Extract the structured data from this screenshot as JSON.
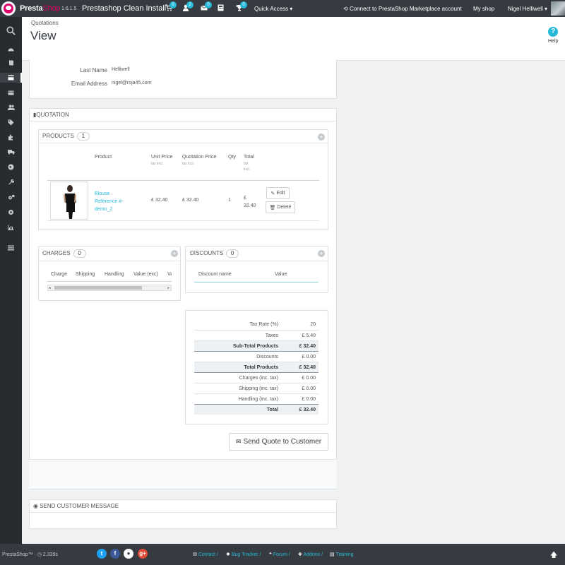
{
  "topbar": {
    "brand_a": "Presta",
    "brand_b": "Shop",
    "version": "1.6.1.5",
    "shop_name": "Prestashop Clean Install",
    "badges": {
      "orders": "0",
      "customers": "2",
      "messages": "0",
      "trophy": "0"
    },
    "quick_access": "Quick Access ▾",
    "connect": "Connect to PrestaShop Marketplace account",
    "my_shop": "My shop",
    "employee": "Nigel Helliwell ▾"
  },
  "header": {
    "breadcrumb": "Quotations",
    "title": "View",
    "help": "Help"
  },
  "customer": {
    "last_name_label": "Last Name",
    "last_name": "Helliwell",
    "email_label": "Email Address",
    "email": "nigel@roja45.com"
  },
  "quotation": {
    "heading": "QUOTATION",
    "products": {
      "heading": "PRODUCTS",
      "count": "1",
      "columns": {
        "product": "Product",
        "unit_price": "Unit Price",
        "unit_price_sub": "tax incl.",
        "quotation_price": "Quotation Price",
        "quotation_price_sub": "tax incl.",
        "qty": "Qty",
        "total": "Total",
        "total_sub1": "tax",
        "total_sub2": "incl."
      },
      "rows": [
        {
          "name": "Blouse",
          "reference": "Reference #:",
          "reference_code": "demo_2",
          "unit_price": "£ 32.40",
          "quotation_price": "£ 32.40",
          "qty": "1",
          "total_a": "£",
          "total_b": "32.40",
          "edit": "Edit",
          "delete": "Delete"
        }
      ]
    },
    "charges": {
      "heading": "CHARGES",
      "count": "0",
      "columns": [
        "Charge",
        "Shipping",
        "Handling",
        "Value (exc)",
        "Va"
      ]
    },
    "discounts": {
      "heading": "DISCOUNTS",
      "count": "0",
      "columns": [
        "Discount name",
        "Value"
      ]
    },
    "totals": [
      {
        "label": "Tax Rate (%)",
        "value": "20"
      },
      {
        "label": "Taxes",
        "value": "£ 5.40"
      },
      {
        "label": "Sub-Total Products",
        "value": "£ 32.40"
      },
      {
        "label": "Discounts",
        "value": "£ 0.00"
      },
      {
        "label": "Total Products",
        "value": "£ 32.40"
      },
      {
        "label": "Charges (inc. tax)",
        "value": "£ 0.00"
      },
      {
        "label": "Shipping (inc. tax)",
        "value": "£ 0.00"
      },
      {
        "label": "Handling (inc. tax)",
        "value": "£ 0.00"
      },
      {
        "label": "Total",
        "value": "£ 32.40"
      }
    ],
    "send_button": "Send Quote to Customer"
  },
  "message_panel": {
    "heading": "SEND CUSTOMER MESSAGE"
  },
  "footer": {
    "brand": "PrestaShop™ ·",
    "time": "2.339s",
    "links": [
      "Contact /",
      "Bug Tracker /",
      "Forum /",
      "Addons /",
      "Training"
    ]
  },
  "colors": {
    "accent": "#25b9d7",
    "topbar": "#363a41",
    "sidebar": "#282b30",
    "brand_pink": "#df0067"
  }
}
